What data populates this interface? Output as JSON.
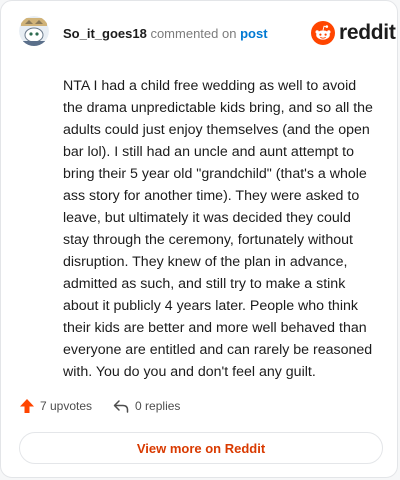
{
  "header": {
    "username": "So_it_goes18",
    "action_text": "commented on",
    "post_link_text": "post",
    "brand_name": "reddit"
  },
  "comment": {
    "body": "NTA I had a child free wedding as well to avoid the drama unpredictable kids bring, and so all the adults could just enjoy themselves (and the open bar lol). I still had an uncle and aunt attempt to bring their 5 year old \"grandchild\" (that's a whole ass story for another time). They were asked to leave, but ultimately it was decided they could stay through the ceremony, fortunately without disruption. They knew of the plan in advance, admitted as such, and still try to make a stink about it publicly 4 years later. People who think their kids are better and more well behaved than everyone are entitled and can rarely be reasoned with. You do you and don't feel any guilt."
  },
  "footer": {
    "upvotes_label": "7 upvotes",
    "replies_label": "0 replies",
    "view_more_label": "View more on Reddit"
  },
  "icons": {
    "upvote": "upvote-arrow-icon",
    "reply": "reply-arrow-icon",
    "logo": "reddit-alien-icon"
  },
  "colors": {
    "brand_orange": "#ff4500",
    "link_blue": "#0079d3",
    "button_text": "#d93a00",
    "muted_text": "#7c7c7c"
  }
}
